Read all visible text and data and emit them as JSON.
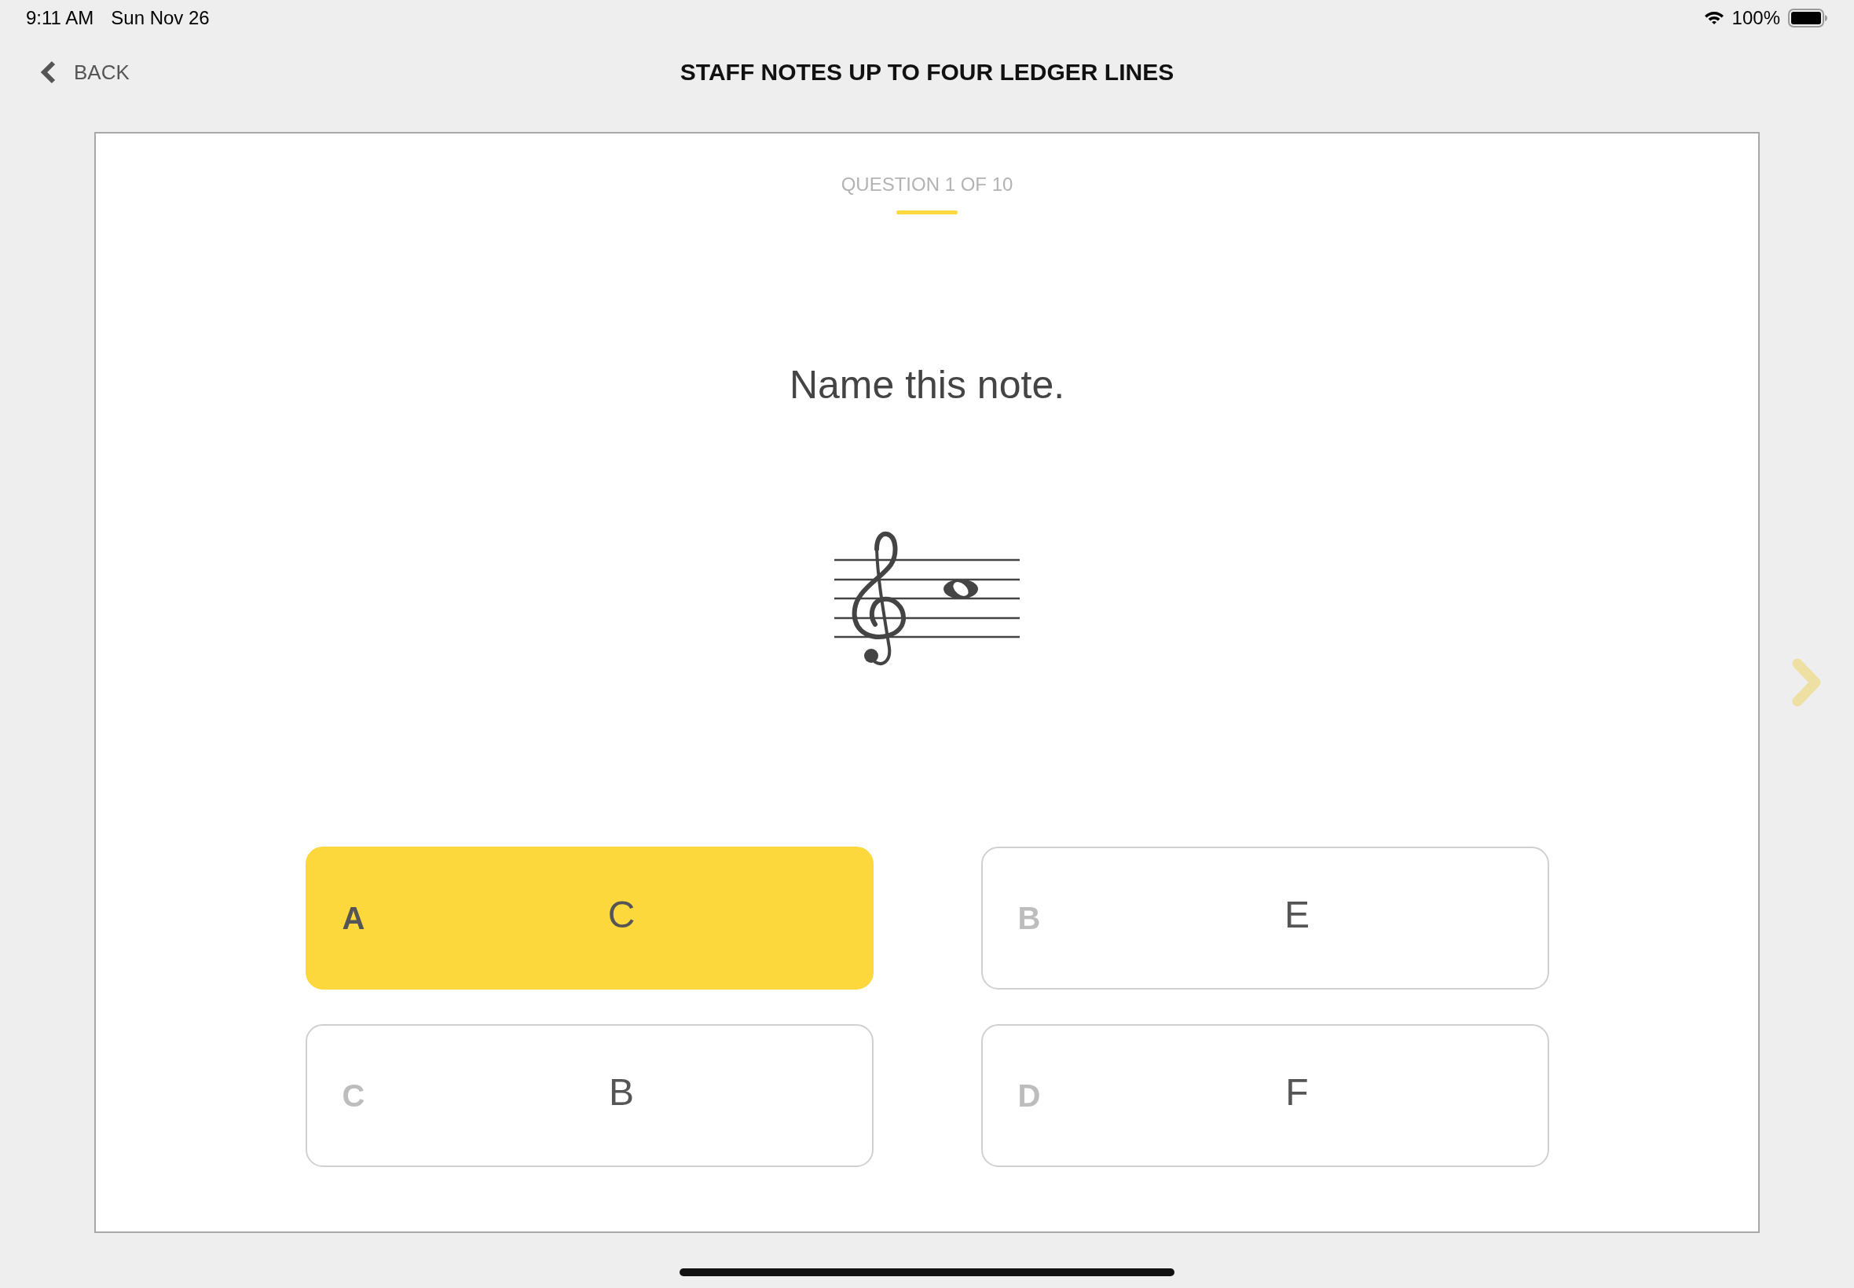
{
  "status_bar": {
    "time": "9:11 AM",
    "date": "Sun Nov 26",
    "battery": "100%"
  },
  "header": {
    "back_label": "BACK",
    "title": "STAFF NOTES UP TO FOUR LEDGER LINES"
  },
  "quiz": {
    "progress": "QUESTION 1 OF 10",
    "prompt": "Name this note.",
    "answers": [
      {
        "letter": "A",
        "value": "C",
        "selected": true
      },
      {
        "letter": "B",
        "value": "E",
        "selected": false
      },
      {
        "letter": "C",
        "value": "B",
        "selected": false
      },
      {
        "letter": "D",
        "value": "F",
        "selected": false
      }
    ]
  },
  "next_button": {
    "disabled": true
  }
}
